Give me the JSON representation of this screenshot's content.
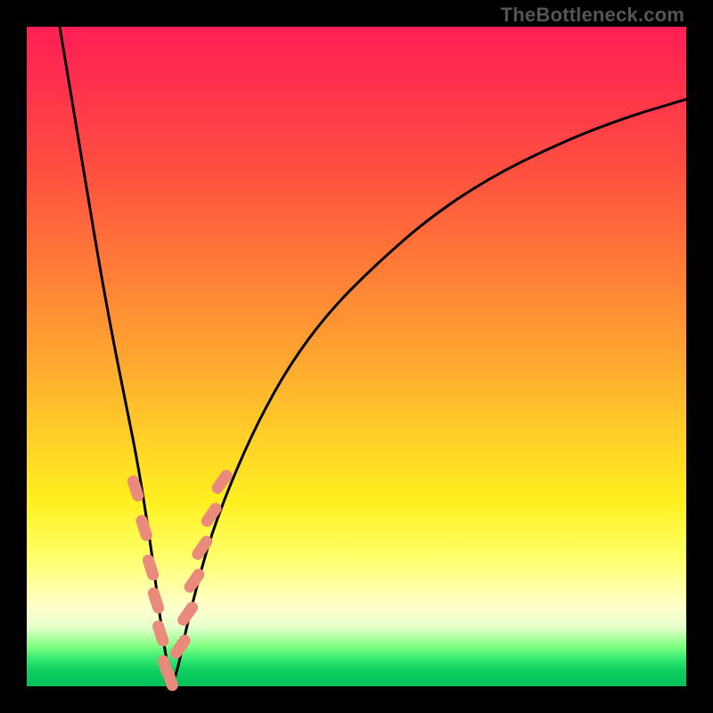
{
  "attribution": "TheBottleneck.com",
  "colors": {
    "curve": "#000000",
    "marker": "#e98a7c",
    "gradient_top": "#ff1f55",
    "gradient_bottom": "#04c058",
    "frame": "#000000"
  },
  "chart_data": {
    "type": "line",
    "title": "",
    "xlabel": "",
    "ylabel": "",
    "xlim": [
      0,
      100
    ],
    "ylim": [
      0,
      100
    ],
    "grid": false,
    "legend": false,
    "comment": "Left branch of V drops from top-left to the trough near x≈22; right branch rises concavely toward upper-right. Salmon dashed highlight runs along the lowest ~30% of both branches around the trough.",
    "series": [
      {
        "name": "curve",
        "x": [
          5,
          7,
          9,
          11,
          13,
          15,
          17,
          19,
          20,
          21,
          22,
          23,
          24,
          26,
          28,
          31,
          35,
          40,
          46,
          53,
          61,
          70,
          80,
          90,
          100
        ],
        "values": [
          100,
          88,
          76,
          64,
          53,
          43,
          33,
          20,
          12,
          5,
          0,
          3,
          8,
          16,
          23,
          31,
          40,
          49,
          57,
          64,
          71,
          77,
          82,
          86,
          89
        ]
      },
      {
        "name": "highlight-dashes",
        "x": [
          16.5,
          17.8,
          18.8,
          19.6,
          20.3,
          21.0,
          21.8,
          23.3,
          24.4,
          25.4,
          26.6,
          28.0,
          29.6
        ],
        "values": [
          30,
          24,
          18,
          13,
          8,
          3,
          1,
          6,
          11,
          16,
          21,
          26,
          31
        ]
      }
    ]
  }
}
